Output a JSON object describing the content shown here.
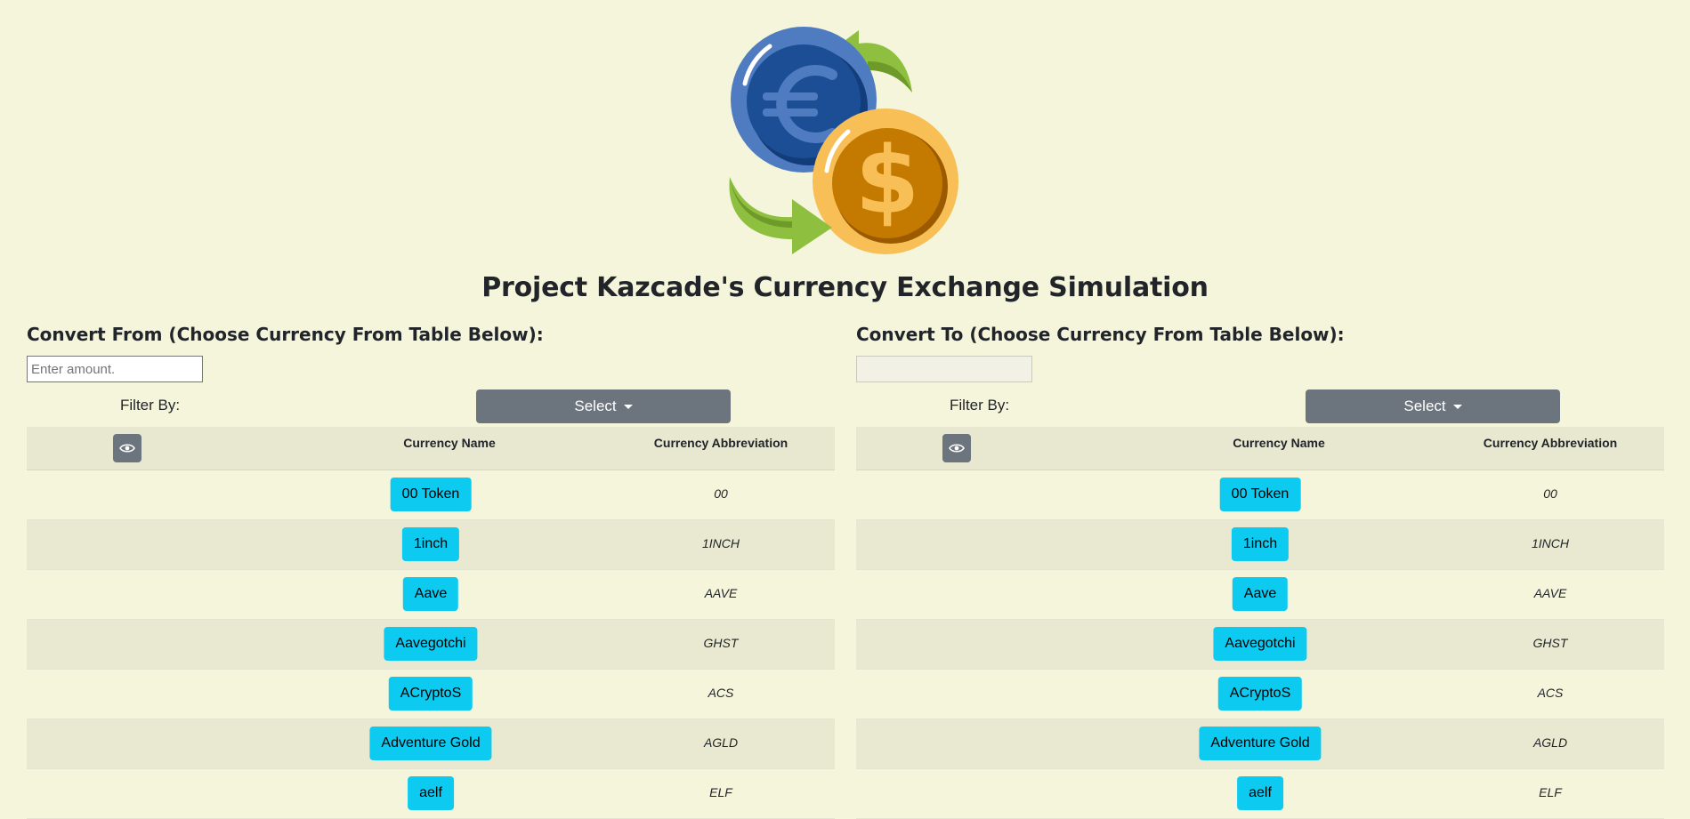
{
  "page": {
    "title": "Project Kazcade's Currency Exchange Simulation",
    "colors": {
      "background": "#f5f5dc",
      "accent_button": "#0dcaf0",
      "secondary_button": "#6c757d"
    }
  },
  "from_panel": {
    "heading": "Convert From (Choose Currency From Table Below):",
    "amount_placeholder": "Enter amount.",
    "filter_label": "Filter By:",
    "select_label": "Select",
    "table_header": {
      "name": "Currency Name",
      "abbreviation": "Currency Abbreviation"
    },
    "rows": [
      {
        "name": "00 Token",
        "abbr": "00"
      },
      {
        "name": "1inch",
        "abbr": "1INCH"
      },
      {
        "name": "Aave",
        "abbr": "AAVE"
      },
      {
        "name": "Aavegotchi",
        "abbr": "GHST"
      },
      {
        "name": "ACryptoS",
        "abbr": "ACS"
      },
      {
        "name": "Adventure Gold",
        "abbr": "AGLD"
      },
      {
        "name": "aelf",
        "abbr": "ELF"
      }
    ]
  },
  "to_panel": {
    "heading": "Convert To (Choose Currency From Table Below):",
    "amount_value": "",
    "filter_label": "Filter By:",
    "select_label": "Select",
    "table_header": {
      "name": "Currency Name",
      "abbreviation": "Currency Abbreviation"
    },
    "rows": [
      {
        "name": "00 Token",
        "abbr": "00"
      },
      {
        "name": "1inch",
        "abbr": "1INCH"
      },
      {
        "name": "Aave",
        "abbr": "AAVE"
      },
      {
        "name": "Aavegotchi",
        "abbr": "GHST"
      },
      {
        "name": "ACryptoS",
        "abbr": "ACS"
      },
      {
        "name": "Adventure Gold",
        "abbr": "AGLD"
      },
      {
        "name": "aelf",
        "abbr": "ELF"
      }
    ]
  },
  "icons": {
    "logo": "currency-exchange-icon",
    "toggle": "eye-icon",
    "dropdown": "caret-down-icon"
  }
}
